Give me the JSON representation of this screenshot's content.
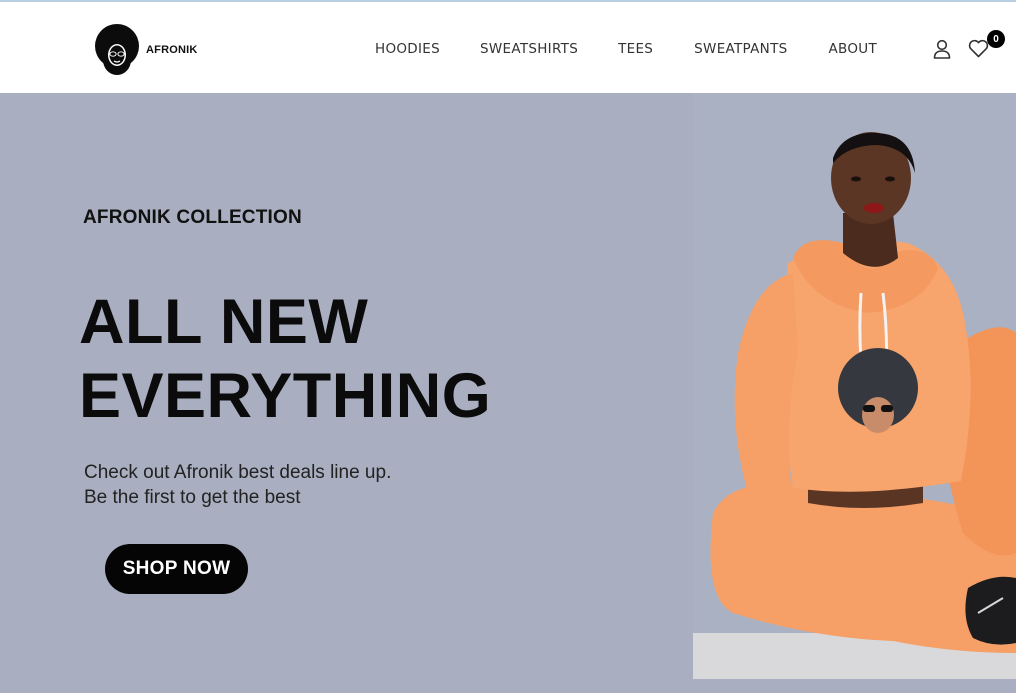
{
  "brand": {
    "name": "AFRONIK"
  },
  "nav": {
    "items": [
      "HOODIES",
      "SWEATSHIRTS",
      "TEES",
      "SWEATPANTS",
      "ABOUT"
    ]
  },
  "header_icons": {
    "account_icon": "user-icon",
    "wishlist_icon": "heart-icon",
    "wishlist_count": "0"
  },
  "hero": {
    "eyebrow": "AFRONIK COLLECTION",
    "headline_line1": "ALL NEW",
    "headline_line2": "EVERYTHING",
    "sub_line1": "Check out Afronik best deals line up.",
    "sub_line2": "Be the first to get the best",
    "cta_label": "SHOP NOW",
    "background_color": "#a9afc0",
    "cta_color": "#050505"
  },
  "hero_image": {
    "subject": "model wearing orange cropped hoodie and sweatpants with afro logo",
    "garment_color": "#f59a62"
  }
}
